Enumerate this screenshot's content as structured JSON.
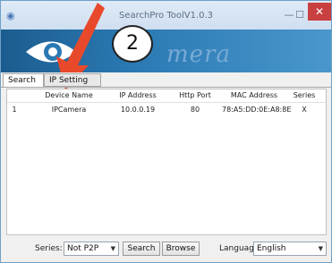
{
  "window": {
    "title": "SearchPro ToolV1.0.3",
    "controls": {
      "minimize": "—",
      "maximize": "☐",
      "close": "✕"
    }
  },
  "banner": {
    "watermark": "mera"
  },
  "callout": {
    "number": "2"
  },
  "tabs": [
    {
      "label": "Search",
      "active": true
    },
    {
      "label": "IP Setting",
      "active": false
    }
  ],
  "table": {
    "headers": [
      "",
      "Device Name",
      "IP Address",
      "Http Port",
      "MAC Address",
      "Series"
    ],
    "rows": [
      [
        "1",
        "IPCamera",
        "10.0.0.19",
        "80",
        "78:A5:DD:0E:A8:8E",
        "X"
      ]
    ]
  },
  "bottom": {
    "series_label": "Series:",
    "series_value": "Not P2P",
    "search_button": "Search",
    "browse_button": "Browse",
    "language_label": "Language",
    "language_value": "English"
  },
  "colors": {
    "arrow": "#e8492b",
    "close": "#c84040",
    "banner": "#2b79b3"
  }
}
